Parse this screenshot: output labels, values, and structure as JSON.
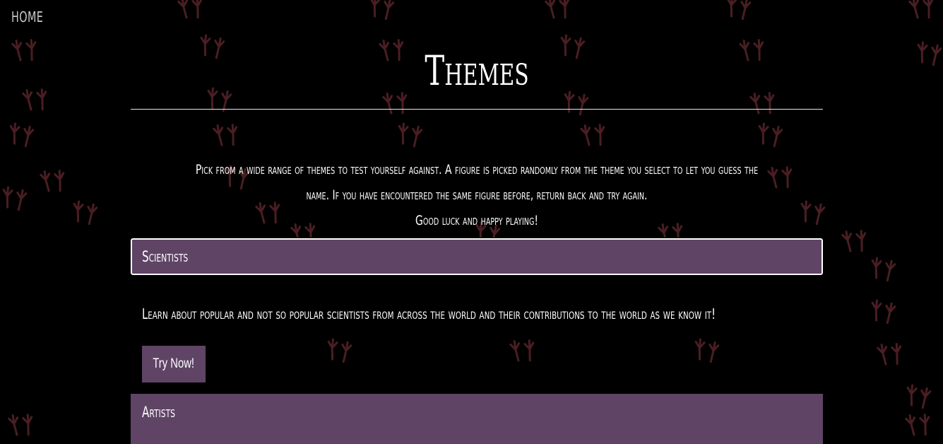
{
  "nav": {
    "home_label": "HOME"
  },
  "page": {
    "title": "Themes"
  },
  "intro": {
    "line1": "Pick from a wide range of themes to test yourself against. A figure is picked randomly from the theme you select to let you guess the name. If you have encountered the same figure before, return back and try again.",
    "line2": "Good luck and happy playing!"
  },
  "themes": [
    {
      "name": "Scientists",
      "expanded": true,
      "description": "Learn about popular and not so popular scientists from across the world and their contributions to the world as we know it!",
      "button_label": "Try Now!"
    },
    {
      "name": "Artists",
      "expanded": false
    }
  ],
  "colors": {
    "background": "#000000",
    "accent": "#5f4466",
    "pattern": "#4a1e22",
    "text": "#ffffff"
  }
}
